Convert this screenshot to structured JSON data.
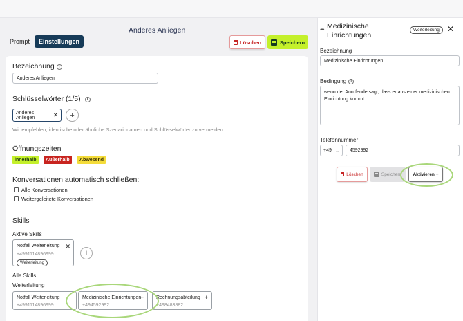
{
  "page": {
    "title": "Anderes Anliegen"
  },
  "tabs": [
    {
      "label": "Prompt",
      "active": false
    },
    {
      "label": "Einstellungen",
      "active": true
    }
  ],
  "toolbar": {
    "delete_label": "Löschen",
    "save_label": "Speichern"
  },
  "form": {
    "bezeichnung": {
      "label": "Bezeichnung",
      "value": "Anderes Anliegen"
    },
    "keywords": {
      "label": "Schlüsselwörter (1/5)",
      "items": [
        "Anderes Anliegen"
      ],
      "hint": "Wir empfehlen, identische oder ähnliche Szenarionamen und Schlüsselwörter zu vermeiden."
    },
    "opening_hours": {
      "label": "Öffnungszeiten",
      "badges": [
        {
          "label": "innerhalb",
          "bg": "#c4f02b",
          "fg": "#1d3a12"
        },
        {
          "label": "Außerhalb",
          "bg": "#c8241f",
          "fg": "#ffffff"
        },
        {
          "label": "Abwesend",
          "bg": "#f4dc3a",
          "fg": "#3a3205"
        }
      ]
    },
    "auto_close": {
      "label": "Konversationen automatisch schließen:",
      "options": [
        {
          "label": "Alle Konversationen",
          "checked": false
        },
        {
          "label": "Weitergeleitete Konversationen",
          "checked": false
        }
      ]
    },
    "skills": {
      "label": "Skills",
      "active_label": "Aktive Skills",
      "active": [
        {
          "name": "Notfall Weiterleitung",
          "phone": "+4991114896999",
          "tag": "Weiterleitung"
        }
      ],
      "all_label": "Alle Skills",
      "group_label": "Weiterleitung",
      "all": [
        {
          "name": "Notfall Weiterleitung",
          "phone": "+4991114896999"
        },
        {
          "name": "Medizinische Einrichtungen",
          "phone": "+494592992"
        },
        {
          "name": "Rechnungsabteilung",
          "phone": "+498483882"
        }
      ]
    }
  },
  "panel": {
    "title": "Medizinische Einrichtungen",
    "type_badge": "Weiterleitung",
    "bezeichnung_label": "Bezeichnung",
    "bezeichnung_value": "Medizinische Einrichtungen",
    "bedingung_label": "Bedingung",
    "bedingung_value": "wenn der Anrufende sagt, dass er aus einer medizinischen Einrichtung kommt",
    "phone_label": "Telefonnummer",
    "phone_prefix": "+49",
    "phone_value": "4592992",
    "delete_label": "Löschen",
    "save_label": "Speichern",
    "activate_label": "Aktivieren +"
  },
  "colors": {
    "primary": "#173b58",
    "accent_green": "#c4f02b",
    "danger": "#c72727",
    "highlight_ring": "#a9d77a"
  }
}
